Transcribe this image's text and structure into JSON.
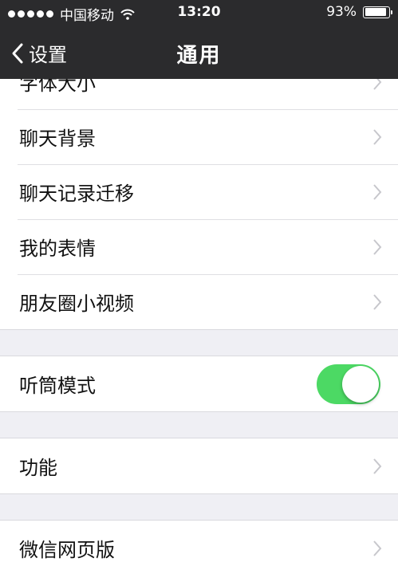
{
  "status_bar": {
    "carrier": "中国移动",
    "time": "13:20",
    "battery_text": "93%",
    "battery_level": 0.93
  },
  "nav": {
    "back_label": "设置",
    "title": "通用"
  },
  "list": {
    "group1": [
      "字体大小",
      "聊天背景",
      "聊天记录迁移",
      "我的表情",
      "朋友圈小视频"
    ],
    "earpiece_mode": {
      "label": "听筒模式",
      "enabled": true
    },
    "features": "功能",
    "web_wechat": "微信网页版"
  },
  "colors": {
    "toggle_on": "#4cd964",
    "nav_background": "#2b2b2d",
    "page_background": "#efeff4"
  }
}
